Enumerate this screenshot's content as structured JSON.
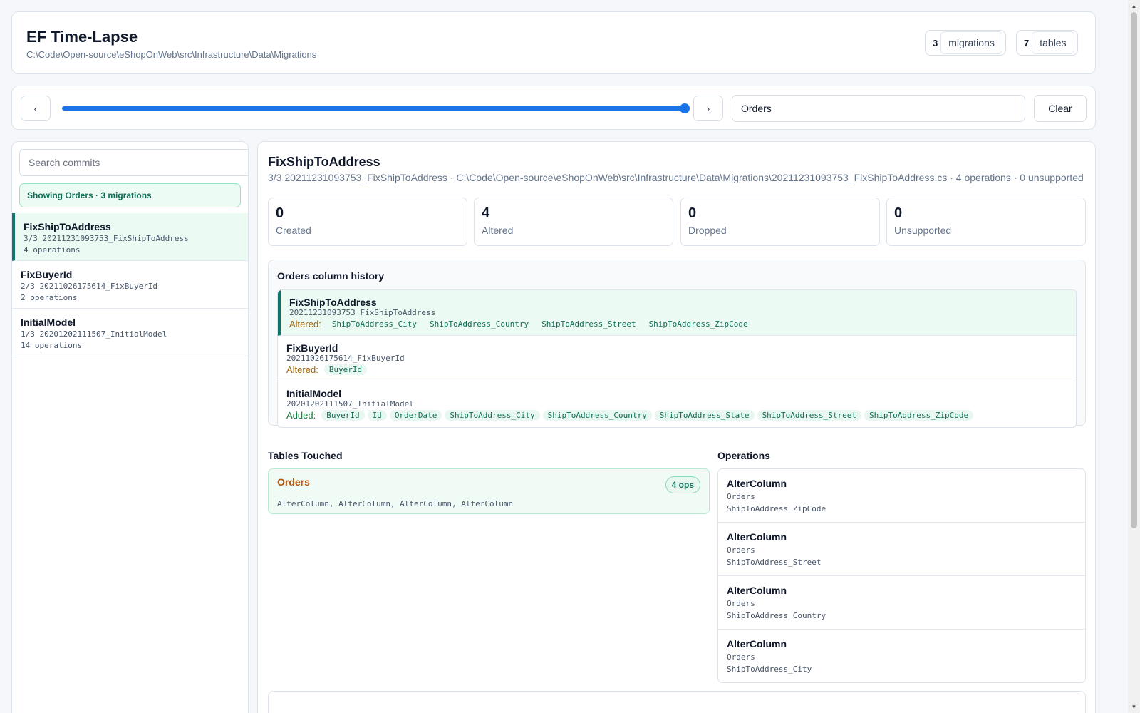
{
  "header": {
    "title": "EF Time-Lapse",
    "path": "C:\\Code\\Open-source\\eShopOnWeb\\src\\Infrastructure\\Data\\Migrations",
    "migrations_count": "3",
    "migrations_label": "migrations",
    "tables_count": "7",
    "tables_label": "tables"
  },
  "toolbar": {
    "prev_label": "‹",
    "next_label": "›",
    "slider_value": 1.0,
    "filter_value": "Orders",
    "clear_label": "Clear"
  },
  "sidebar": {
    "search_placeholder": "Search commits",
    "filter_banner": "Showing Orders · 3 migrations",
    "commits": [
      {
        "name": "FixShipToAddress",
        "id": "3/3 20211231093753_FixShipToAddress",
        "ops": "4 operations"
      },
      {
        "name": "FixBuyerId",
        "id": "2/3 20211026175614_FixBuyerId",
        "ops": "2 operations"
      },
      {
        "name": "InitialModel",
        "id": "1/3 20201202111507_InitialModel",
        "ops": "14 operations"
      }
    ]
  },
  "main": {
    "title": "FixShipToAddress",
    "subtitle": "3/3 20211231093753_FixShipToAddress · C:\\Code\\Open-source\\eShopOnWeb\\src\\Infrastructure\\Data\\Migrations\\20211231093753_FixShipToAddress.cs · 4 operations · 0 unsupported",
    "stats": [
      {
        "value": "0",
        "label": "Created"
      },
      {
        "value": "4",
        "label": "Altered"
      },
      {
        "value": "0",
        "label": "Dropped"
      },
      {
        "value": "0",
        "label": "Unsupported"
      }
    ],
    "history": {
      "title": "Orders column history",
      "rows": [
        {
          "name": "FixShipToAddress",
          "id": "20211231093753_FixShipToAddress",
          "kind": "Altered:",
          "columns": [
            "ShipToAddress_City",
            "ShipToAddress_Country",
            "ShipToAddress_Street",
            "ShipToAddress_ZipCode"
          ]
        },
        {
          "name": "FixBuyerId",
          "id": "20211026175614_FixBuyerId",
          "kind": "Altered:",
          "columns": [
            "BuyerId"
          ]
        },
        {
          "name": "InitialModel",
          "id": "20201202111507_InitialModel",
          "kind": "Added:",
          "columns": [
            "BuyerId",
            "Id",
            "OrderDate",
            "ShipToAddress_City",
            "ShipToAddress_Country",
            "ShipToAddress_State",
            "ShipToAddress_Street",
            "ShipToAddress_ZipCode"
          ]
        }
      ]
    },
    "tables_touched": {
      "title": "Tables Touched",
      "table": "Orders",
      "ops_badge": "4 ops",
      "operations": "AlterColumn, AlterColumn, AlterColumn, AlterColumn"
    },
    "operations": {
      "title": "Operations",
      "items": [
        {
          "type": "AlterColumn",
          "table": "Orders",
          "column": "ShipToAddress_ZipCode"
        },
        {
          "type": "AlterColumn",
          "table": "Orders",
          "column": "ShipToAddress_Street"
        },
        {
          "type": "AlterColumn",
          "table": "Orders",
          "column": "ShipToAddress_Country"
        },
        {
          "type": "AlterColumn",
          "table": "Orders",
          "column": "ShipToAddress_City"
        }
      ]
    }
  },
  "colors": {
    "accent": "#1a73e8",
    "active_border": "#0f766e",
    "active_bg": "#ebfbf3",
    "altered": "#a16207",
    "added": "#15803d"
  }
}
